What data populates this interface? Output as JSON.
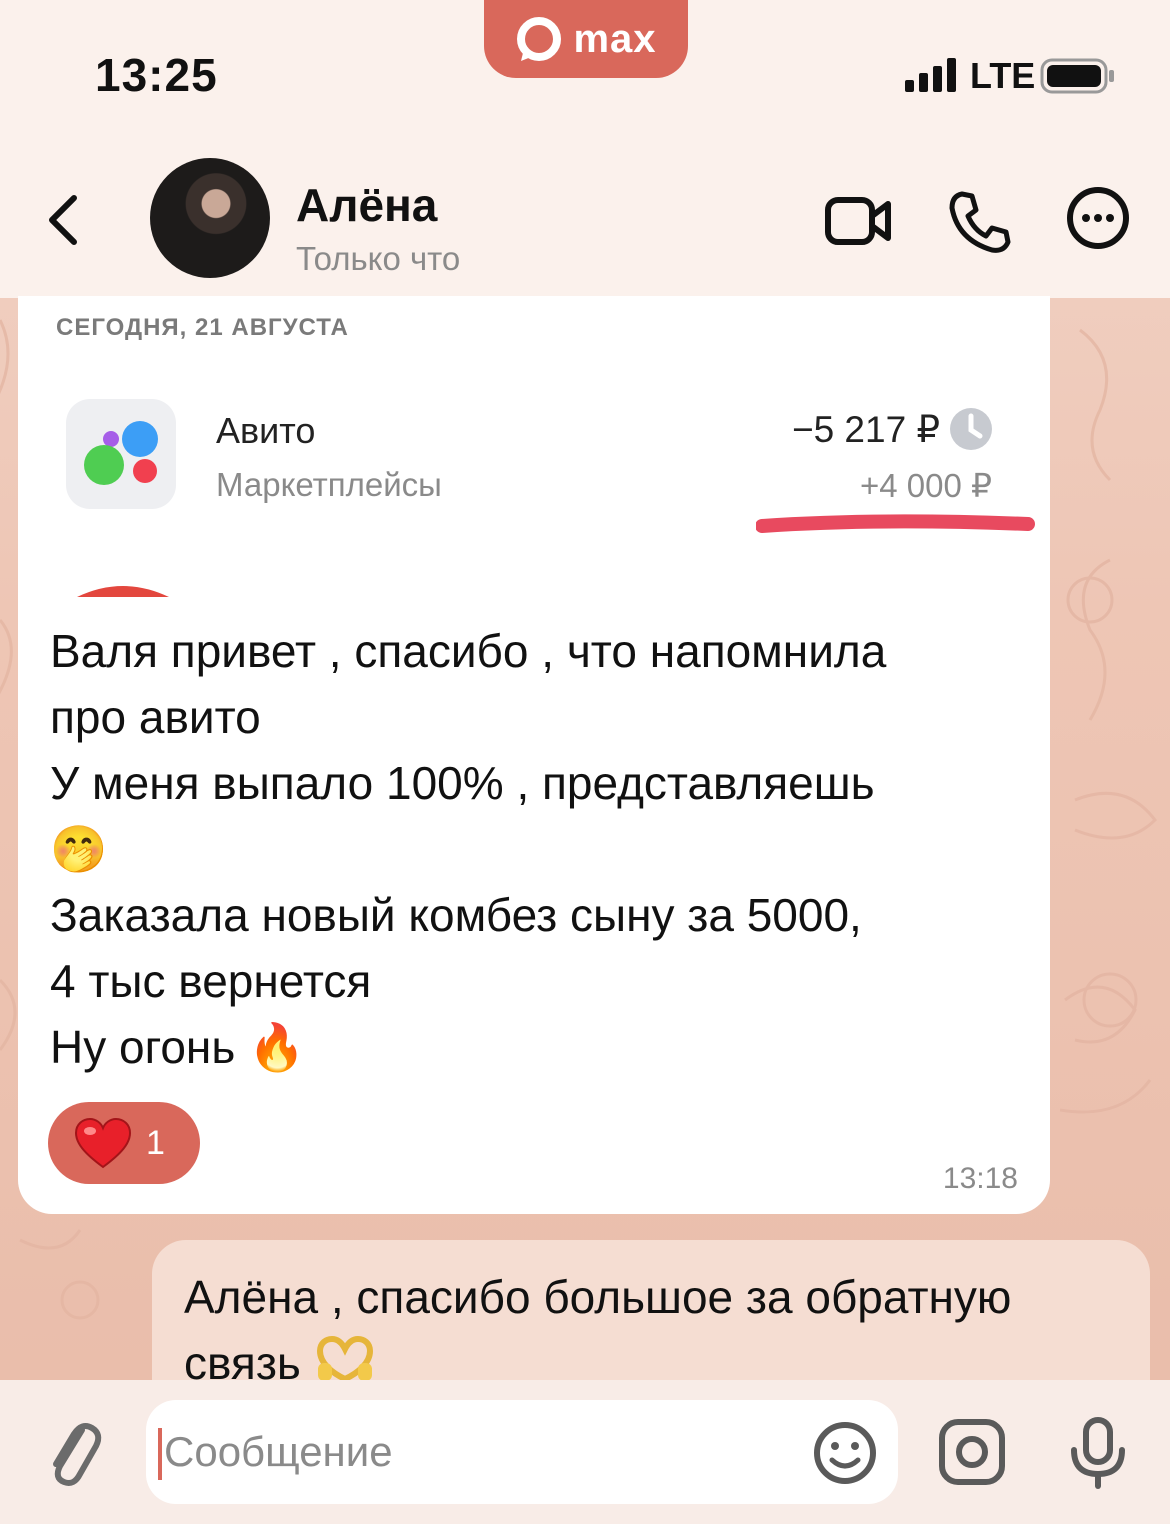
{
  "status_bar": {
    "time": "13:25",
    "network": "LTE",
    "app_badge": "max"
  },
  "header": {
    "contact_name": "Алёна",
    "contact_status": "Только что"
  },
  "incoming_message": {
    "date_label": "СЕГОДНЯ, 21 АВГУСТА",
    "transaction": {
      "merchant": "Авито",
      "category": "Маркетплейсы",
      "amount": "−5 217 ₽",
      "cashback": "+4 000 ₽"
    },
    "text": "Валя привет , спасибо , что напомнила\nпро авито\nУ меня выпало 100% , представляешь\n🤭\nЗаказала новый комбез сыну  за 5000,\n4 тыс вернется\nНу огонь 🔥",
    "reaction_emoji": "heart-icon",
    "reaction_count": "1",
    "time": "13:18"
  },
  "outgoing_message": {
    "text": "Алёна , спасибо большое за обратную связь",
    "emoji": "heart-hands-icon"
  },
  "composer": {
    "placeholder": "Сообщение"
  },
  "colors": {
    "accent": "#d9685b",
    "underline": "#e84a5f"
  }
}
